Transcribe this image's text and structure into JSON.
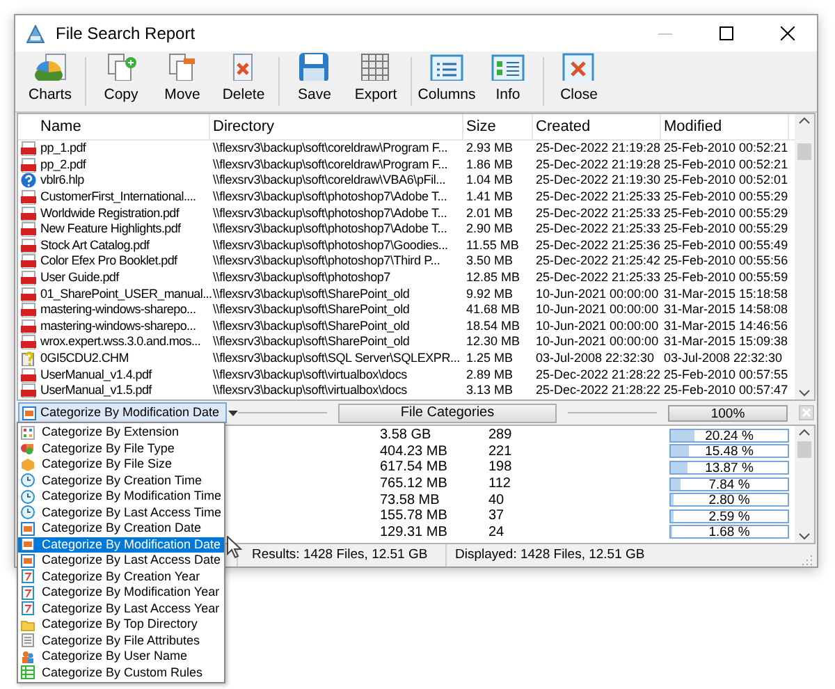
{
  "window": {
    "title": "File Search Report"
  },
  "toolbar": {
    "groups": [
      [
        {
          "label": "Charts",
          "kind": "charts"
        }
      ],
      [
        {
          "label": "Copy",
          "kind": "copy"
        },
        {
          "label": "Move",
          "kind": "move"
        },
        {
          "label": "Delete",
          "kind": "delete"
        }
      ],
      [
        {
          "label": "Save",
          "kind": "save"
        },
        {
          "label": "Export",
          "kind": "export"
        }
      ],
      [
        {
          "label": "Columns",
          "kind": "columns"
        },
        {
          "label": "Info",
          "kind": "info"
        }
      ],
      [
        {
          "label": "Close",
          "kind": "close"
        }
      ]
    ]
  },
  "table": {
    "columns": [
      "Name",
      "Directory",
      "Size",
      "Created",
      "Modified"
    ],
    "rows": [
      {
        "kind": "pdf",
        "cells": [
          "pp_1.pdf",
          "\\\\flexsrv3\\backup\\soft\\coreldraw\\Program F...",
          "2.93 MB",
          "25-Dec-2022 21:19:28",
          "25-Feb-2010 00:52:21"
        ]
      },
      {
        "kind": "pdf",
        "cells": [
          "pp_2.pdf",
          "\\\\flexsrv3\\backup\\soft\\coreldraw\\Program F...",
          "1.86 MB",
          "25-Dec-2022 21:19:28",
          "25-Feb-2010 00:52:21"
        ]
      },
      {
        "kind": "help",
        "cells": [
          "vblr6.hlp",
          "\\\\flexsrv3\\backup\\soft\\coreldraw\\VBA6\\pFil...",
          "1.04 MB",
          "25-Dec-2022 21:19:30",
          "25-Feb-2010 00:52:01"
        ]
      },
      {
        "kind": "pdf",
        "cells": [
          "CustomerFirst_International....",
          "\\\\flexsrv3\\backup\\soft\\photoshop7\\Adobe T...",
          "1.41 MB",
          "25-Dec-2022 21:25:33",
          "25-Feb-2010 00:55:29"
        ]
      },
      {
        "kind": "pdf",
        "cells": [
          "Worldwide Registration.pdf",
          "\\\\flexsrv3\\backup\\soft\\photoshop7\\Adobe T...",
          "2.01 MB",
          "25-Dec-2022 21:25:33",
          "25-Feb-2010 00:55:29"
        ]
      },
      {
        "kind": "pdf",
        "cells": [
          "New Feature Highlights.pdf",
          "\\\\flexsrv3\\backup\\soft\\photoshop7\\Adobe T...",
          "2.90 MB",
          "25-Dec-2022 21:25:33",
          "25-Feb-2010 00:55:29"
        ]
      },
      {
        "kind": "pdf",
        "cells": [
          "Stock Art Catalog.pdf",
          "\\\\flexsrv3\\backup\\soft\\photoshop7\\Goodies...",
          "11.55 MB",
          "25-Dec-2022 21:25:36",
          "25-Feb-2010 00:55:49"
        ]
      },
      {
        "kind": "pdf",
        "cells": [
          "Color Efex Pro Booklet.pdf",
          "\\\\flexsrv3\\backup\\soft\\photoshop7\\Third P...",
          "3.50 MB",
          "25-Dec-2022 21:25:42",
          "25-Feb-2010 00:55:56"
        ]
      },
      {
        "kind": "pdf",
        "cells": [
          "User Guide.pdf",
          "\\\\flexsrv3\\backup\\soft\\photoshop7",
          "12.85 MB",
          "25-Dec-2022 21:25:33",
          "25-Feb-2010 00:55:59"
        ]
      },
      {
        "kind": "pdf",
        "cells": [
          "01_SharePoint_USER_manual...",
          "\\\\flexsrv3\\backup\\soft\\SharePoint_old",
          "9.92 MB",
          "10-Jun-2021 00:00:00",
          "31-Mar-2015 15:18:58"
        ]
      },
      {
        "kind": "pdf",
        "cells": [
          "mastering-windows-sharepo...",
          "\\\\flexsrv3\\backup\\soft\\SharePoint_old",
          "41.68 MB",
          "10-Jun-2021 00:00:00",
          "31-Mar-2015 14:58:08"
        ]
      },
      {
        "kind": "pdf",
        "cells": [
          "mastering-windows-sharepo...",
          "\\\\flexsrv3\\backup\\soft\\SharePoint_old",
          "18.54 MB",
          "10-Jun-2021 00:00:00",
          "31-Mar-2015 14:46:56"
        ]
      },
      {
        "kind": "pdf",
        "cells": [
          "wrox.expert.wss.3.0.and.mos...",
          "\\\\flexsrv3\\backup\\soft\\SharePoint_old",
          "12.30 MB",
          "10-Jun-2021 00:00:00",
          "31-Mar-2015 15:09:38"
        ]
      },
      {
        "kind": "chm",
        "cells": [
          "0GI5CDU2.CHM",
          "\\\\flexsrv3\\backup\\soft\\SQL Server\\SQLEXPR...",
          "1.25 MB",
          "03-Jul-2008 22:32:30",
          "03-Jul-2008 22:32:30"
        ]
      },
      {
        "kind": "pdf",
        "cells": [
          "UserManual_v1.4.pdf",
          "\\\\flexsrv3\\backup\\soft\\virtualbox\\docs",
          "2.89 MB",
          "25-Dec-2022 21:28:22",
          "25-Feb-2010 00:57:55"
        ]
      },
      {
        "kind": "pdf",
        "cells": [
          "UserManual_v1.5.pdf",
          "\\\\flexsrv3\\backup\\soft\\virtualbox\\docs",
          "3.13 MB",
          "25-Dec-2022 21:28:22",
          "25-Feb-2010 00:57:47"
        ]
      }
    ]
  },
  "category_bar": {
    "combo_value": "Categorize By Modification Date",
    "button": "File Categories",
    "progress": {
      "label": "100%",
      "level": 1
    }
  },
  "categories": [
    {
      "size": "3.58 GB",
      "count": "289",
      "percent": "20.24 %",
      "level": 0.2024
    },
    {
      "size": "404.23 MB",
      "count": "221",
      "percent": "15.48 %",
      "level": 0.1548
    },
    {
      "size": "617.54 MB",
      "count": "198",
      "percent": "13.87 %",
      "level": 0.1387
    },
    {
      "size": "765.12 MB",
      "count": "112",
      "percent": "7.84 %",
      "level": 0.0784
    },
    {
      "size": "73.58 MB",
      "count": "40",
      "percent": "2.80 %",
      "level": 0.028
    },
    {
      "size": "155.78 MB",
      "count": "37",
      "percent": "2.59 %",
      "level": 0.0259
    },
    {
      "size": "129.31 MB",
      "count": "24",
      "percent": "1.68 %",
      "level": 0.0168
    }
  ],
  "status_bar": [
    "Results: 1428 Files, 12.51 GB",
    "Displayed: 1428 Files, 12.51 GB"
  ],
  "dropdown": [
    {
      "label": "Categorize By Extension",
      "kind": "grid",
      "selected": false
    },
    {
      "label": "Categorize By File Type",
      "kind": "types",
      "selected": false
    },
    {
      "label": "Categorize By File Size",
      "kind": "box",
      "selected": false
    },
    {
      "label": "Categorize By Creation Time",
      "kind": "clock",
      "selected": false
    },
    {
      "label": "Categorize By Modification Time",
      "kind": "clock",
      "selected": false
    },
    {
      "label": "Categorize By Last Access Time",
      "kind": "clock",
      "selected": false
    },
    {
      "label": "Categorize By Creation Date",
      "kind": "date",
      "selected": false
    },
    {
      "label": "Categorize By Modification Date",
      "kind": "date",
      "selected": true
    },
    {
      "label": "Categorize By Last Access Date",
      "kind": "date",
      "selected": false
    },
    {
      "label": "Categorize By Creation Year",
      "kind": "year",
      "selected": false
    },
    {
      "label": "Categorize By Modification Year",
      "kind": "year",
      "selected": false
    },
    {
      "label": "Categorize By Last Access Year",
      "kind": "year",
      "selected": false
    },
    {
      "label": "Categorize By Top Directory",
      "kind": "folder",
      "selected": false
    },
    {
      "label": "Categorize By File Attributes",
      "kind": "attributes",
      "selected": false
    },
    {
      "label": "Categorize By User Name",
      "kind": "user",
      "selected": false
    },
    {
      "label": "Categorize By Custom Rules",
      "kind": "rules",
      "selected": false
    }
  ]
}
